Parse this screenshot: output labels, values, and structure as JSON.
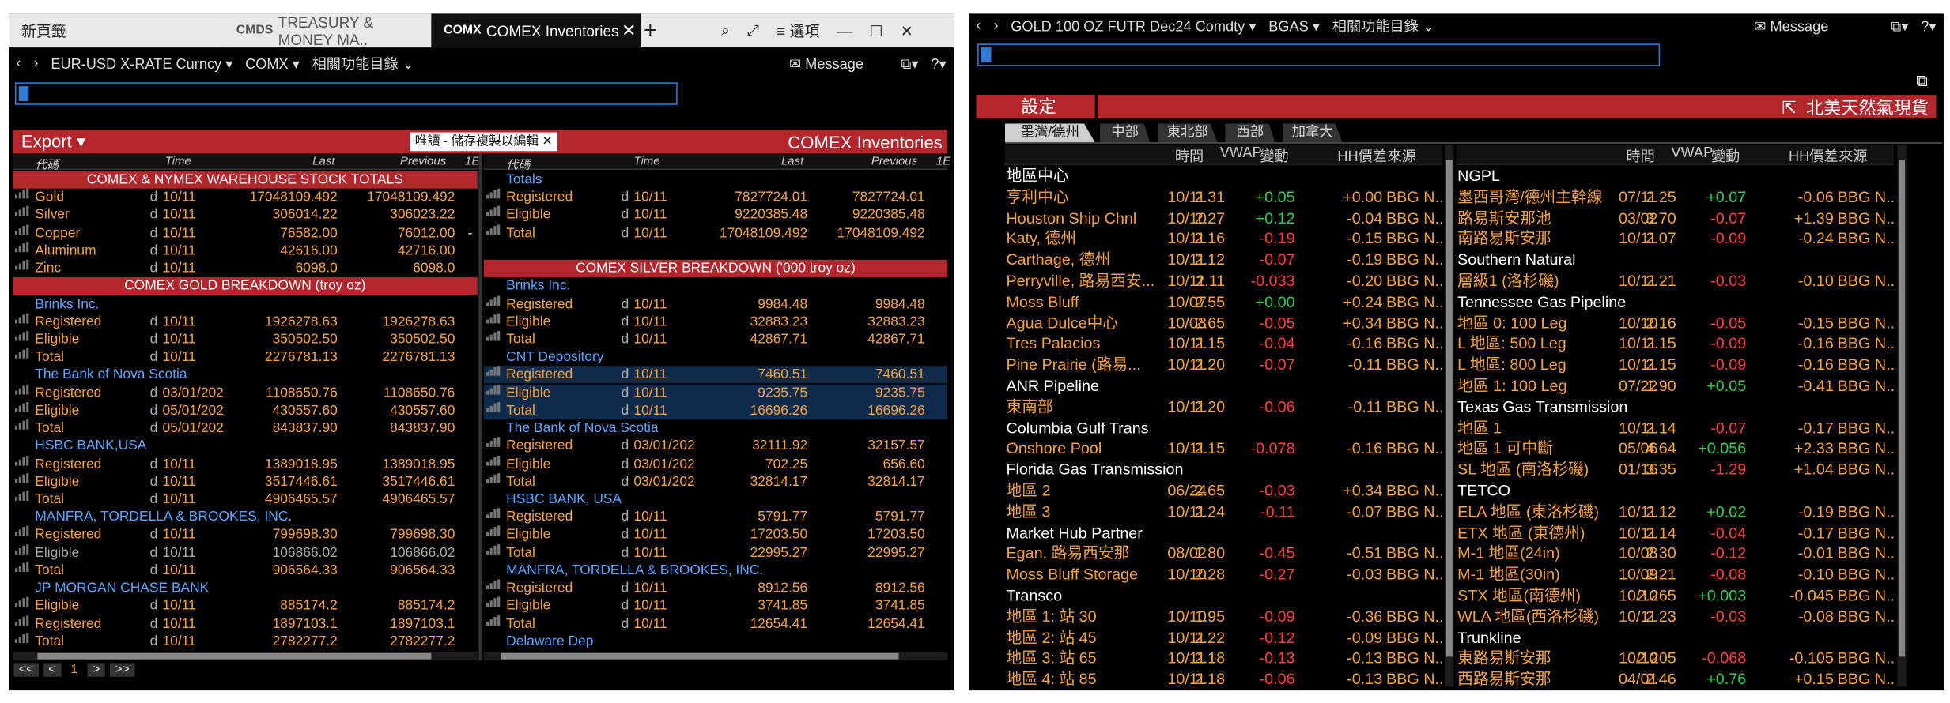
{
  "left": {
    "tabs": [
      {
        "label": "新頁籤"
      },
      {
        "badge": "CMDS",
        "label": "TREASURY & MONEY MA.."
      },
      {
        "badge": "COMX",
        "label": "COMEX Inventories"
      }
    ],
    "menu_label": "選項",
    "security": "EUR-USD X-RATE Curncy",
    "source": "COMX",
    "related": "相關功能目錄",
    "message": "Message",
    "export": "Export",
    "readonly": "唯讀 - 儲存複製以編輯",
    "title": "COMEX Inventories",
    "cols": {
      "code": "代碼",
      "time": "Time",
      "last": "Last",
      "previous": "Previous",
      "extra": "1E"
    },
    "page": "1",
    "colA": [
      {
        "t": "sect",
        "name": "COMEX & NYMEX WAREHOUSE STOCK TOTALS"
      },
      {
        "t": "d",
        "name": "Gold",
        "time": "10/11",
        "last": "17048109.492",
        "prev": "17048109.492"
      },
      {
        "t": "d",
        "name": "Silver",
        "time": "10/11",
        "last": "306014.22",
        "prev": "306023.22"
      },
      {
        "t": "d",
        "name": "Copper",
        "time": "10/11",
        "last": "76582.00",
        "prev": "76012.00",
        "mk": "-"
      },
      {
        "t": "d",
        "name": "Aluminum",
        "time": "10/11",
        "last": "42616.00",
        "prev": "42716.00"
      },
      {
        "t": "d",
        "name": "Zinc",
        "time": "10/11",
        "last": "6098.0",
        "prev": "6098.0"
      },
      {
        "t": "sect",
        "name": "COMEX GOLD BREAKDOWN (troy oz)"
      },
      {
        "t": "h",
        "name": "Brinks Inc."
      },
      {
        "t": "d",
        "name": "Registered",
        "time": "10/11",
        "last": "1926278.63",
        "prev": "1926278.63"
      },
      {
        "t": "d",
        "name": "Eligible",
        "time": "10/11",
        "last": "350502.50",
        "prev": "350502.50"
      },
      {
        "t": "d",
        "name": "Total",
        "time": "10/11",
        "last": "2276781.13",
        "prev": "2276781.13"
      },
      {
        "t": "h",
        "name": "The Bank of Nova Scotia"
      },
      {
        "t": "d",
        "name": "Registered",
        "time": "03/01/202",
        "last": "1108650.76",
        "prev": "1108650.76"
      },
      {
        "t": "d",
        "name": "Eligible",
        "time": "05/01/202",
        "last": "430557.60",
        "prev": "430557.60"
      },
      {
        "t": "d",
        "name": "Total",
        "time": "05/01/202",
        "last": "843837.90",
        "prev": "843837.90"
      },
      {
        "t": "h",
        "name": "HSBC BANK,USA"
      },
      {
        "t": "d",
        "name": "Registered",
        "time": "10/11",
        "last": "1389018.95",
        "prev": "1389018.95"
      },
      {
        "t": "d",
        "name": "Eligible",
        "time": "10/11",
        "last": "3517446.61",
        "prev": "3517446.61"
      },
      {
        "t": "d",
        "name": "Total",
        "time": "10/11",
        "last": "4906465.57",
        "prev": "4906465.57"
      },
      {
        "t": "h",
        "name": "MANFRA, TORDELLA & BROOKES, INC."
      },
      {
        "t": "d",
        "name": "Registered",
        "time": "10/11",
        "last": "799698.30",
        "prev": "799698.30"
      },
      {
        "t": "d",
        "name": "Eligible",
        "time": "10/11",
        "last": "106866.02",
        "prev": "106866.02",
        "dim": true
      },
      {
        "t": "d",
        "name": "Total",
        "time": "10/11",
        "last": "906564.33",
        "prev": "906564.33"
      },
      {
        "t": "h",
        "name": "JP MORGAN CHASE BANK"
      },
      {
        "t": "d",
        "name": "Eligible",
        "time": "10/11",
        "last": "885174.2",
        "prev": "885174.2"
      },
      {
        "t": "d",
        "name": "Registered",
        "time": "10/11",
        "last": "1897103.1",
        "prev": "1897103.1"
      },
      {
        "t": "d",
        "name": "Total",
        "time": "10/11",
        "last": "2782277.2",
        "prev": "2782277.2"
      }
    ],
    "colB": [
      {
        "t": "h",
        "name": "Totals"
      },
      {
        "t": "d",
        "name": "Registered",
        "time": "10/11",
        "last": "7827724.01",
        "prev": "7827724.01"
      },
      {
        "t": "d",
        "name": "Eligible",
        "time": "10/11",
        "last": "9220385.48",
        "prev": "9220385.48"
      },
      {
        "t": "d",
        "name": "Total",
        "time": "10/11",
        "last": "17048109.492",
        "prev": "17048109.492"
      },
      {
        "t": "blank"
      },
      {
        "t": "sect",
        "name": "COMEX SILVER BREAKDOWN ('000 troy oz)"
      },
      {
        "t": "h",
        "name": "Brinks Inc."
      },
      {
        "t": "d",
        "name": "Registered",
        "time": "10/11",
        "last": "9984.48",
        "prev": "9984.48"
      },
      {
        "t": "d",
        "name": "Eligible",
        "time": "10/11",
        "last": "32883.23",
        "prev": "32883.23"
      },
      {
        "t": "d",
        "name": "Total",
        "time": "10/11",
        "last": "42867.71",
        "prev": "42867.71"
      },
      {
        "t": "h",
        "name": "CNT Depository"
      },
      {
        "t": "d",
        "name": "Registered",
        "time": "10/11",
        "last": "7460.51",
        "prev": "7460.51",
        "sel": true
      },
      {
        "t": "d",
        "name": "Eligible",
        "time": "10/11",
        "last": "9235.75",
        "prev": "9235.75",
        "sel": true
      },
      {
        "t": "d",
        "name": "Total",
        "time": "10/11",
        "last": "16696.26",
        "prev": "16696.26",
        "sel": true
      },
      {
        "t": "h",
        "name": "The Bank of Nova Scotia"
      },
      {
        "t": "d",
        "name": "Registered",
        "time": "03/01/202",
        "last": "32111.92",
        "prev": "32157.57"
      },
      {
        "t": "d",
        "name": "Eligible",
        "time": "03/01/202",
        "last": "702.25",
        "prev": "656.60"
      },
      {
        "t": "d",
        "name": "Total",
        "time": "03/01/202",
        "last": "32814.17",
        "prev": "32814.17"
      },
      {
        "t": "h",
        "name": "HSBC BANK, USA"
      },
      {
        "t": "d",
        "name": "Registered",
        "time": "10/11",
        "last": "5791.77",
        "prev": "5791.77"
      },
      {
        "t": "d",
        "name": "Eligible",
        "time": "10/11",
        "last": "17203.50",
        "prev": "17203.50"
      },
      {
        "t": "d",
        "name": "Total",
        "time": "10/11",
        "last": "22995.27",
        "prev": "22995.27"
      },
      {
        "t": "h",
        "name": "MANFRA, TORDELLA & BROOKES, INC."
      },
      {
        "t": "d",
        "name": "Registered",
        "time": "10/11",
        "last": "8912.56",
        "prev": "8912.56"
      },
      {
        "t": "d",
        "name": "Eligible",
        "time": "10/11",
        "last": "3741.85",
        "prev": "3741.85"
      },
      {
        "t": "d",
        "name": "Total",
        "time": "10/11",
        "last": "12654.41",
        "prev": "12654.41"
      },
      {
        "t": "h",
        "name": "Delaware Dep"
      }
    ]
  },
  "right": {
    "security": "GOLD 100 OZ FUTR Dec24 Comdty",
    "source": "BGAS",
    "related": "相關功能目錄",
    "message": "Message",
    "settings": "設定",
    "title": "北美天然氣現貨",
    "tabs": [
      "墨灣/德州",
      "中部",
      "東北部",
      "西部",
      "加拿大"
    ],
    "cols": {
      "time": "時間",
      "vwap": "VWAP",
      "chg": "變動",
      "hh": "HH價差",
      "src": "來源"
    },
    "colA": [
      {
        "t": "h",
        "name": "地區中心"
      },
      {
        "t": "d",
        "name": "亨利中心",
        "time": "10/11",
        "vwap": "2.31",
        "chg": "+0.05",
        "hh": "+0.00",
        "src": "BBG N..."
      },
      {
        "t": "d",
        "name": "Houston Ship Chnl",
        "time": "10/10",
        "vwap": "2.27",
        "chg": "+0.12",
        "hh": "-0.04",
        "src": "BBG N..."
      },
      {
        "t": "d",
        "name": "Katy, 德州",
        "time": "10/11",
        "vwap": "2.16",
        "chg": "-0.19",
        "hh": "-0.15",
        "src": "BBG N..."
      },
      {
        "t": "d",
        "name": "Carthage, 德州",
        "time": "10/11",
        "vwap": "2.12",
        "chg": "-0.07",
        "hh": "-0.19",
        "src": "BBG N..."
      },
      {
        "t": "d",
        "name": "Perryville, 路易西安...",
        "time": "10/11",
        "vwap": "2.11",
        "chg": "-0.033",
        "hh": "-0.20",
        "src": "BBG N..."
      },
      {
        "t": "d",
        "name": "Moss Bluff",
        "time": "10/07",
        "vwap": "2.55",
        "chg": "+0.00",
        "hh": "+0.24",
        "src": "BBG N..."
      },
      {
        "t": "d",
        "name": "Agua Dulce中心",
        "time": "10/03",
        "vwap": "2.65",
        "chg": "-0.05",
        "hh": "+0.34",
        "src": "BBG N..."
      },
      {
        "t": "d",
        "name": "Tres Palacios",
        "time": "10/11",
        "vwap": "2.15",
        "chg": "-0.04",
        "hh": "-0.16",
        "src": "BBG N..."
      },
      {
        "t": "d",
        "name": "Pine Prairie (路易...",
        "time": "10/11",
        "vwap": "2.20",
        "chg": "-0.07",
        "hh": "-0.11",
        "src": "BBG N..."
      },
      {
        "t": "h",
        "name": "ANR Pipeline"
      },
      {
        "t": "d",
        "name": "東南部",
        "time": "10/11",
        "vwap": "2.20",
        "chg": "-0.06",
        "hh": "-0.11",
        "src": "BBG N..."
      },
      {
        "t": "h",
        "name": "Columbia Gulf Trans"
      },
      {
        "t": "d",
        "name": "Onshore Pool",
        "time": "10/11",
        "vwap": "2.15",
        "chg": "-0.078",
        "hh": "-0.16",
        "src": "BBG N..."
      },
      {
        "t": "h",
        "name": "Florida Gas Transmission"
      },
      {
        "t": "d",
        "name": "地區 2",
        "time": "06/24",
        "vwap": "2.65",
        "chg": "-0.03",
        "hh": "+0.34",
        "src": "BBG N..."
      },
      {
        "t": "d",
        "name": "地區 3",
        "time": "10/11",
        "vwap": "2.24",
        "chg": "-0.11",
        "hh": "-0.07",
        "src": "BBG N..."
      },
      {
        "t": "h",
        "name": "Market Hub Partner"
      },
      {
        "t": "d",
        "name": "Egan, 路易西安那",
        "time": "08/02",
        "vwap": "1.80",
        "chg": "-0.45",
        "hh": "-0.51",
        "src": "BBG N..."
      },
      {
        "t": "d",
        "name": "Moss Bluff Storage",
        "time": "10/10",
        "vwap": "2.28",
        "chg": "-0.27",
        "hh": "-0.03",
        "src": "BBG N..."
      },
      {
        "t": "h",
        "name": "Transco"
      },
      {
        "t": "d",
        "name": "地區 1: 站 30",
        "time": "10/10",
        "vwap": "1.95",
        "chg": "-0.09",
        "hh": "-0.36",
        "src": "BBG N..."
      },
      {
        "t": "d",
        "name": "地區 2: 站 45",
        "time": "10/11",
        "vwap": "2.22",
        "chg": "-0.12",
        "hh": "-0.09",
        "src": "BBG N..."
      },
      {
        "t": "d",
        "name": "地區 3: 站 65",
        "time": "10/11",
        "vwap": "2.18",
        "chg": "-0.13",
        "hh": "-0.13",
        "src": "BBG N..."
      },
      {
        "t": "d",
        "name": "地區 4: 站 85",
        "time": "10/11",
        "vwap": "2.18",
        "chg": "-0.06",
        "hh": "-0.13",
        "src": "BBG N..."
      }
    ],
    "colB": [
      {
        "t": "h",
        "name": "NGPL"
      },
      {
        "t": "d",
        "name": "墨西哥灣/德州主幹線",
        "time": "07/11",
        "vwap": "2.25",
        "chg": "+0.07",
        "hh": "-0.06",
        "src": "BBG N..."
      },
      {
        "t": "d",
        "name": "路易斯安那池",
        "time": "03/02",
        "vwap": "3.70",
        "chg": "-0.07",
        "hh": "+1.39",
        "src": "BBG N..."
      },
      {
        "t": "d",
        "name": "南路易斯安那",
        "time": "10/11",
        "vwap": "2.07",
        "chg": "-0.09",
        "hh": "-0.24",
        "src": "BBG N..."
      },
      {
        "t": "h",
        "name": "Southern Natural"
      },
      {
        "t": "d",
        "name": "層級1 (洛杉磯)",
        "time": "10/11",
        "vwap": "2.21",
        "chg": "-0.03",
        "hh": "-0.10",
        "src": "BBG N..."
      },
      {
        "t": "h",
        "name": "Tennessee Gas Pipeline"
      },
      {
        "t": "d",
        "name": "地區 0: 100 Leg",
        "time": "10/10",
        "vwap": "2.16",
        "chg": "-0.05",
        "hh": "-0.15",
        "src": "BBG N..."
      },
      {
        "t": "d",
        "name": "L 地區: 500 Leg",
        "time": "10/11",
        "vwap": "2.15",
        "chg": "-0.09",
        "hh": "-0.16",
        "src": "BBG N..."
      },
      {
        "t": "d",
        "name": "L 地區: 800 Leg",
        "time": "10/11",
        "vwap": "2.15",
        "chg": "-0.09",
        "hh": "-0.16",
        "src": "BBG N..."
      },
      {
        "t": "d",
        "name": "地區 1: 100 Leg",
        "time": "07/22",
        "vwap": "1.90",
        "chg": "+0.05",
        "hh": "-0.41",
        "src": "BBG N..."
      },
      {
        "t": "h",
        "name": "Texas Gas Transmission"
      },
      {
        "t": "d",
        "name": "地區 1",
        "time": "10/11",
        "vwap": "2.14",
        "chg": "-0.07",
        "hh": "-0.17",
        "src": "BBG N..."
      },
      {
        "t": "d",
        "name": "地區 1 可中斷",
        "time": "05/06",
        "vwap": "4.64",
        "chg": "+0.056",
        "hh": "+2.33",
        "src": "BBG N..."
      },
      {
        "t": "d",
        "name": "SL 地區 (南洛杉磯)",
        "time": "01/16",
        "vwap": "3.35",
        "chg": "-1.29",
        "hh": "+1.04",
        "src": "BBG N..."
      },
      {
        "t": "h",
        "name": "TETCO"
      },
      {
        "t": "d",
        "name": "ELA 地區 (東洛杉磯)",
        "time": "10/11",
        "vwap": "2.12",
        "chg": "+0.02",
        "hh": "-0.19",
        "src": "BBG N..."
      },
      {
        "t": "d",
        "name": "ETX 地區 (東德州)",
        "time": "10/11",
        "vwap": "2.14",
        "chg": "-0.04",
        "hh": "-0.17",
        "src": "BBG N..."
      },
      {
        "t": "d",
        "name": "M-1 地區(24in)",
        "time": "10/08",
        "vwap": "2.30",
        "chg": "-0.12",
        "hh": "-0.01",
        "src": "BBG N..."
      },
      {
        "t": "d",
        "name": "M-1 地區(30in)",
        "time": "10/09",
        "vwap": "2.21",
        "chg": "-0.08",
        "hh": "-0.10",
        "src": "BBG N..."
      },
      {
        "t": "d",
        "name": "STX 地區(南德州)",
        "time": "10/10",
        "vwap": "2.265",
        "chg": "+0.003",
        "hh": "-0.045",
        "src": "BBG N..."
      },
      {
        "t": "d",
        "name": "WLA 地區(西洛杉磯)",
        "time": "10/11",
        "vwap": "2.23",
        "chg": "-0.03",
        "hh": "-0.08",
        "src": "BBG N..."
      },
      {
        "t": "h",
        "name": "Trunkline"
      },
      {
        "t": "d",
        "name": "東路易斯安那",
        "time": "10/10",
        "vwap": "2.205",
        "chg": "-0.068",
        "hh": "-0.105",
        "src": "BBG N..."
      },
      {
        "t": "d",
        "name": "西路易斯安那",
        "time": "04/01",
        "vwap": "2.46",
        "chg": "+0.76",
        "hh": "+0.15",
        "src": "BBG N..."
      }
    ]
  }
}
